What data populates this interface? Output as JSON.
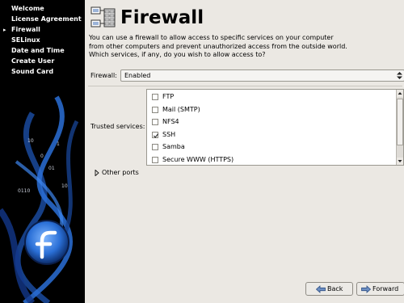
{
  "sidebar": {
    "items": [
      {
        "label": "Welcome",
        "current": false
      },
      {
        "label": "License Agreement",
        "current": false
      },
      {
        "label": "Firewall",
        "current": true
      },
      {
        "label": "SELinux",
        "current": false
      },
      {
        "label": "Date and Time",
        "current": false
      },
      {
        "label": "Create User",
        "current": false
      },
      {
        "label": "Sound Card",
        "current": false
      }
    ],
    "current_marker": "▸",
    "logo_icon": "fedora-logo-icon"
  },
  "header": {
    "title": "Firewall",
    "icon": "firewall-network-icon"
  },
  "intro_text": "You can use a firewall to allow access to specific services on your computer from other computers and prevent unauthorized access from the outside world.  Which services, if any, do you wish to allow access to?",
  "firewall": {
    "label": "Firewall:",
    "value": "Enabled"
  },
  "trusted_services": {
    "label": "Trusted services:",
    "items": [
      {
        "label": "FTP",
        "checked": false
      },
      {
        "label": "Mail (SMTP)",
        "checked": false
      },
      {
        "label": "NFS4",
        "checked": false
      },
      {
        "label": "SSH",
        "checked": true
      },
      {
        "label": "Samba",
        "checked": false
      },
      {
        "label": "Secure WWW (HTTPS)",
        "checked": false
      }
    ]
  },
  "other_ports": {
    "label": "Other ports",
    "expanded": false
  },
  "buttons": {
    "back": "Back",
    "forward": "Forward"
  },
  "colors": {
    "sidebar_bg": "#000000",
    "sidebar_accent": "#2a6fd6",
    "window_bg": "#ebe8e3"
  }
}
